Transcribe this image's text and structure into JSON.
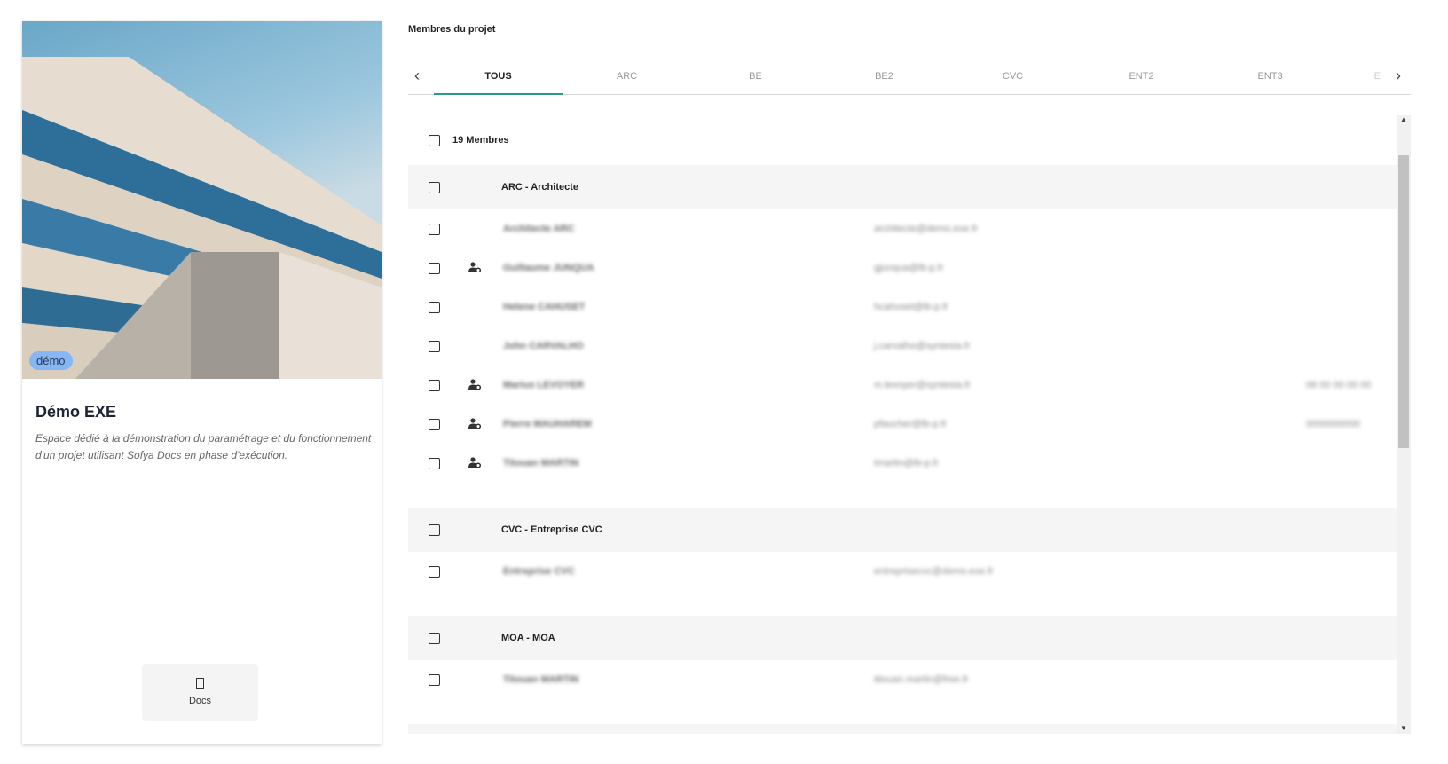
{
  "project": {
    "badge": "démo",
    "title": "Démo EXE",
    "description": "Espace dédié à la démonstration du paramétrage et du fonctionnement d'un projet utilisant Sofya Docs en phase d'exécution.",
    "docs_label": "Docs"
  },
  "members": {
    "title": "Membres du projet",
    "tabs": [
      "TOUS",
      "ARC",
      "BE",
      "BE2",
      "CVC",
      "ENT2",
      "ENT3",
      "E"
    ],
    "count_label": "19 Membres",
    "groups": [
      {
        "label": "ARC - Architecte",
        "members": [
          {
            "name": "Architecte ARC",
            "email": "architecte@demo.exe.fr",
            "phone": "",
            "admin": false
          },
          {
            "name": "Guillaume JUNQUA",
            "email": "gjunqua@lb-p.fr",
            "phone": "",
            "admin": true
          },
          {
            "name": "Helene CAHUSET",
            "email": "hcahuset@lb-p.fr",
            "phone": "",
            "admin": false
          },
          {
            "name": "John CARVALHO",
            "email": "j.carvalho@syntesia.fr",
            "phone": "",
            "admin": false
          },
          {
            "name": "Marius LEVOYER",
            "email": "m.levoyer@syntesia.fr",
            "phone": "06 00 00 00 00",
            "admin": true
          },
          {
            "name": "Pierre MAUHAREM",
            "email": "pfaucher@lb-p.fr",
            "phone": "0000000000",
            "admin": true
          },
          {
            "name": "Titouan MARTIN",
            "email": "tmartin@lb-p.fr",
            "phone": "",
            "admin": true
          }
        ]
      },
      {
        "label": "CVC - Entreprise CVC",
        "members": [
          {
            "name": "Entreprise CVC",
            "email": "entreprisecvc@demo.exe.fr",
            "phone": "",
            "admin": false
          }
        ]
      },
      {
        "label": "MOA - MOA",
        "members": [
          {
            "name": "Titouan MARTIN",
            "email": "titouan.martin@free.fr",
            "phone": "",
            "admin": false
          }
        ]
      }
    ]
  }
}
